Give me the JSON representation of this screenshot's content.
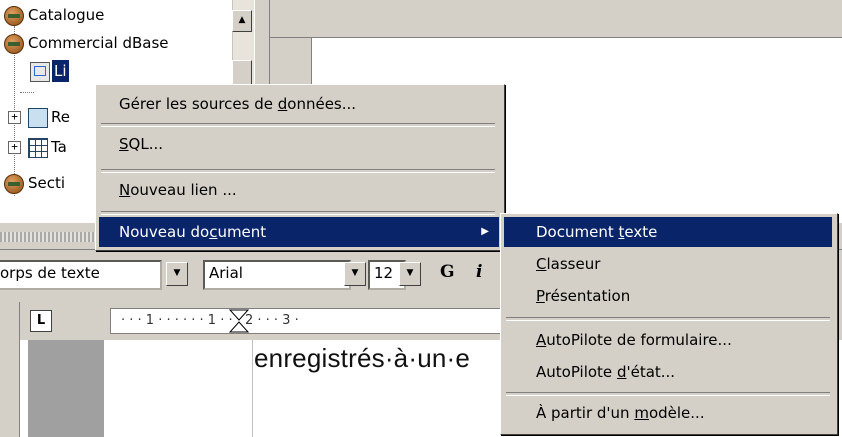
{
  "tree": {
    "items": [
      {
        "label": "Catalogue",
        "icon": "database-icon"
      },
      {
        "label": "Commercial dBase",
        "icon": "database-icon"
      },
      {
        "label": "Li",
        "icon": "link-icon"
      },
      {
        "label": "Re",
        "icon": "query-icon"
      },
      {
        "label": "Ta",
        "icon": "table-icon"
      },
      {
        "label": "Secti",
        "icon": "database-icon"
      }
    ]
  },
  "context_menu": {
    "items": [
      {
        "pre": "Gérer les sources de ",
        "acc": "d",
        "post": "onnées..."
      },
      {
        "pre": "",
        "acc": "S",
        "post": "QL..."
      },
      {
        "pre": "",
        "acc": "N",
        "post": "ouveau lien ..."
      },
      {
        "pre": "Nouveau do",
        "acc": "c",
        "post": "ument"
      }
    ],
    "arrow": "▶"
  },
  "submenu": {
    "items": [
      {
        "pre": "Document ",
        "acc": "t",
        "post": "exte"
      },
      {
        "pre": "",
        "acc": "C",
        "post": "lasseur"
      },
      {
        "pre": "",
        "acc": "P",
        "post": "résentation"
      },
      {
        "pre": "",
        "acc": "A",
        "post": "utoPilote de formulaire..."
      },
      {
        "pre": "AutoPilote ",
        "acc": "d",
        "post": "'état..."
      },
      {
        "pre": "À partir d'un ",
        "acc": "m",
        "post": "odèle..."
      }
    ]
  },
  "toolbar": {
    "style_value": "orps de texte",
    "font_value": "Arial",
    "size_value": "12",
    "bold_label": "G",
    "italic_label": "i"
  },
  "ruler": {
    "text": "· · · 1 · · · · · · 1 · · · 2 · · · 3 ·"
  },
  "document": {
    "text": "enregistrés·à·un·e"
  },
  "colors": {
    "menu_bg": "#d4d0c8",
    "selection": "#0a246a",
    "doc_grey": "#a0a0a0"
  }
}
